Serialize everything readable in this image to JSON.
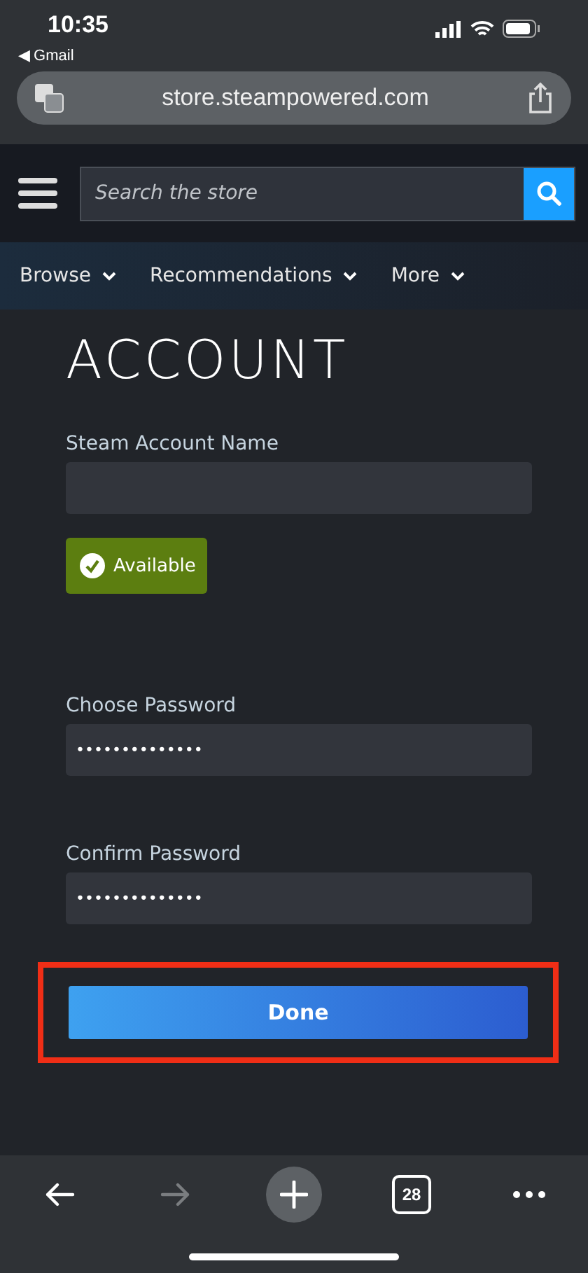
{
  "status_bar": {
    "time": "10:35",
    "back_app": "◀ Gmail"
  },
  "browser": {
    "url": "store.steampowered.com"
  },
  "header": {
    "search": {
      "placeholder": "Search the store"
    }
  },
  "nav": [
    {
      "label": "Browse"
    },
    {
      "label": "Recommendations"
    },
    {
      "label": "More"
    }
  ],
  "page": {
    "title": "ACCOUNT",
    "fields": [
      {
        "label": "Steam Account Name",
        "kind": "text",
        "status": {
          "label": "Available",
          "kind": "ok"
        }
      },
      {
        "label": "Choose Password",
        "kind": "password",
        "value": "••••••••••••••"
      },
      {
        "label": "Confirm Password",
        "kind": "password",
        "value": "••••••••••••••"
      }
    ],
    "done_button": {
      "label": "Done",
      "highlighted": true
    }
  },
  "toolbar": [
    {
      "kind": "back",
      "disabled": false
    },
    {
      "kind": "forward",
      "disabled": true
    },
    {
      "kind": "new-tab",
      "disabled": false
    },
    {
      "kind": "tabs",
      "label": "28",
      "disabled": false
    },
    {
      "kind": "more",
      "disabled": false
    }
  ]
}
